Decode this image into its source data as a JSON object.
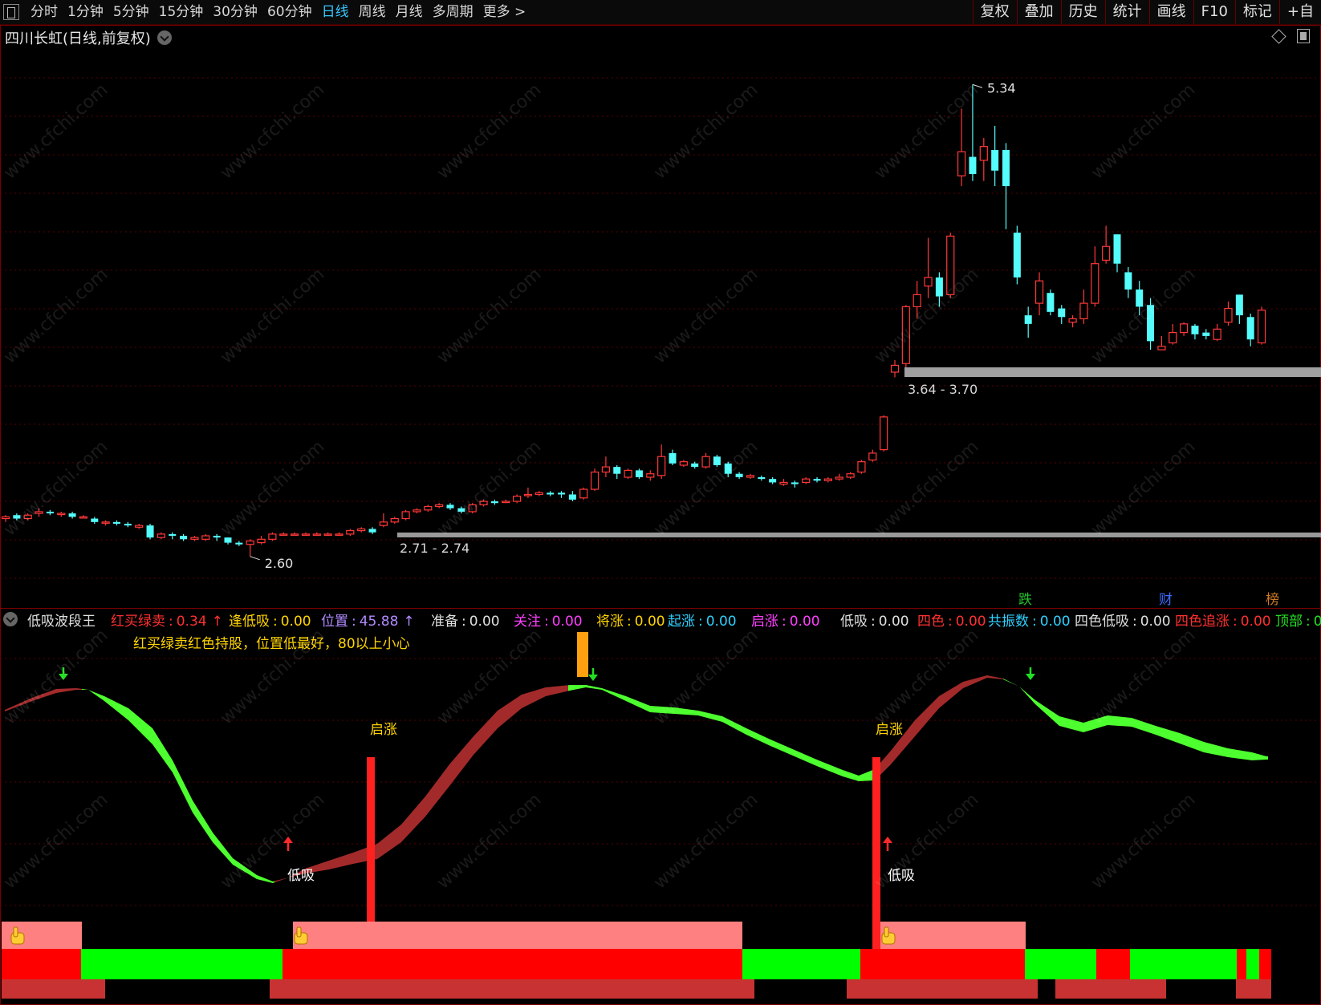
{
  "toolbar": {
    "periods": [
      "分时",
      "1分钟",
      "5分钟",
      "15分钟",
      "30分钟",
      "60分钟",
      "日线",
      "周线",
      "月线",
      "多周期",
      "更多 >"
    ],
    "active_period": "日线",
    "right_buttons": [
      "复权",
      "叠加",
      "历史",
      "统计",
      "画线",
      "F10",
      "标记",
      "+自"
    ]
  },
  "stock": {
    "title": "四川长虹(日线,前复权)"
  },
  "price_chart": {
    "high_label": "5.34",
    "low_label": "2.60",
    "band_low_label": "2.71 - 2.74",
    "band_high_label": "3.64 - 3.70",
    "markers": [
      {
        "text": "跌",
        "color": "#22c02a"
      },
      {
        "text": "财",
        "color": "#3b6cff"
      },
      {
        "text": "榜",
        "color": "#d07a20"
      }
    ],
    "price_range": [
      2.45,
      5.5
    ],
    "candles": [
      [
        2.82,
        2.83,
        2.8,
        2.84
      ],
      [
        2.84,
        2.82,
        2.81,
        2.85
      ],
      [
        2.82,
        2.84,
        2.81,
        2.85
      ],
      [
        2.85,
        2.86,
        2.83,
        2.88
      ],
      [
        2.86,
        2.85,
        2.84,
        2.87
      ],
      [
        2.85,
        2.85,
        2.83,
        2.86
      ],
      [
        2.85,
        2.83,
        2.82,
        2.86
      ],
      [
        2.83,
        2.83,
        2.82,
        2.84
      ],
      [
        2.82,
        2.8,
        2.79,
        2.83
      ],
      [
        2.8,
        2.8,
        2.78,
        2.81
      ],
      [
        2.8,
        2.79,
        2.78,
        2.81
      ],
      [
        2.79,
        2.78,
        2.77,
        2.8
      ],
      [
        2.77,
        2.78,
        2.76,
        2.79
      ],
      [
        2.78,
        2.71,
        2.7,
        2.79
      ],
      [
        2.71,
        2.73,
        2.7,
        2.74
      ],
      [
        2.73,
        2.72,
        2.7,
        2.74
      ],
      [
        2.72,
        2.7,
        2.69,
        2.73
      ],
      [
        2.7,
        2.71,
        2.69,
        2.72
      ],
      [
        2.7,
        2.72,
        2.69,
        2.73
      ],
      [
        2.72,
        2.71,
        2.69,
        2.73
      ],
      [
        2.71,
        2.68,
        2.67,
        2.71
      ],
      [
        2.68,
        2.67,
        2.66,
        2.69
      ],
      [
        2.67,
        2.69,
        2.6,
        2.7
      ],
      [
        2.68,
        2.7,
        2.67,
        2.72
      ],
      [
        2.7,
        2.73,
        2.69,
        2.74
      ],
      [
        2.73,
        2.73,
        2.72,
        2.74
      ],
      [
        2.73,
        2.73,
        2.72,
        2.74
      ],
      [
        2.73,
        2.73,
        2.72,
        2.74
      ],
      [
        2.73,
        2.73,
        2.72,
        2.74
      ],
      [
        2.73,
        2.73,
        2.72,
        2.74
      ],
      [
        2.73,
        2.73,
        2.72,
        2.74
      ],
      [
        2.73,
        2.75,
        2.72,
        2.76
      ],
      [
        2.75,
        2.76,
        2.74,
        2.77
      ],
      [
        2.76,
        2.74,
        2.73,
        2.77
      ],
      [
        2.78,
        2.8,
        2.77,
        2.85
      ],
      [
        2.8,
        2.82,
        2.79,
        2.83
      ],
      [
        2.82,
        2.86,
        2.81,
        2.87
      ],
      [
        2.86,
        2.87,
        2.85,
        2.88
      ],
      [
        2.87,
        2.89,
        2.86,
        2.9
      ],
      [
        2.89,
        2.9,
        2.88,
        2.91
      ],
      [
        2.9,
        2.88,
        2.87,
        2.91
      ],
      [
        2.88,
        2.86,
        2.85,
        2.89
      ],
      [
        2.86,
        2.9,
        2.85,
        2.91
      ],
      [
        2.9,
        2.92,
        2.89,
        2.93
      ],
      [
        2.92,
        2.91,
        2.9,
        2.93
      ],
      [
        2.92,
        2.92,
        2.91,
        2.93
      ],
      [
        2.92,
        2.95,
        2.91,
        2.96
      ],
      [
        2.96,
        2.96,
        2.94,
        3.0
      ],
      [
        2.96,
        2.97,
        2.95,
        2.98
      ],
      [
        2.97,
        2.96,
        2.95,
        2.98
      ],
      [
        2.97,
        2.96,
        2.94,
        2.98
      ],
      [
        2.96,
        2.93,
        2.92,
        2.98
      ],
      [
        2.94,
        2.99,
        2.93,
        3.0
      ],
      [
        2.99,
        3.09,
        2.98,
        3.11
      ],
      [
        3.09,
        3.12,
        3.06,
        3.18
      ],
      [
        3.12,
        3.08,
        3.05,
        3.13
      ],
      [
        3.06,
        3.1,
        3.05,
        3.11
      ],
      [
        3.1,
        3.06,
        3.05,
        3.11
      ],
      [
        3.06,
        3.08,
        3.04,
        3.1
      ],
      [
        3.07,
        3.18,
        3.05,
        3.25
      ],
      [
        3.2,
        3.14,
        3.13,
        3.22
      ],
      [
        3.13,
        3.15,
        3.12,
        3.16
      ],
      [
        3.14,
        3.12,
        3.11,
        3.15
      ],
      [
        3.12,
        3.18,
        3.11,
        3.2
      ],
      [
        3.18,
        3.13,
        3.12,
        3.19
      ],
      [
        3.14,
        3.08,
        3.06,
        3.15
      ],
      [
        3.08,
        3.06,
        3.05,
        3.09
      ],
      [
        3.06,
        3.07,
        3.05,
        3.08
      ],
      [
        3.06,
        3.05,
        3.04,
        3.07
      ],
      [
        3.05,
        3.03,
        3.02,
        3.06
      ],
      [
        3.02,
        3.03,
        3.01,
        3.05
      ],
      [
        3.03,
        3.02,
        3.0,
        3.04
      ],
      [
        3.03,
        3.05,
        3.02,
        3.06
      ],
      [
        3.05,
        3.04,
        3.03,
        3.06
      ],
      [
        3.04,
        3.05,
        3.03,
        3.06
      ],
      [
        3.05,
        3.06,
        3.04,
        3.08
      ],
      [
        3.06,
        3.08,
        3.05,
        3.09
      ],
      [
        3.09,
        3.15,
        3.08,
        3.16
      ],
      [
        3.16,
        3.2,
        3.15,
        3.22
      ],
      [
        3.22,
        3.41,
        3.21,
        3.42
      ],
      [
        3.67,
        3.71,
        3.64,
        3.74
      ],
      [
        3.72,
        4.05,
        3.66,
        4.06
      ],
      [
        4.05,
        4.12,
        3.98,
        4.2
      ],
      [
        4.17,
        4.22,
        4.1,
        4.45
      ],
      [
        4.22,
        4.11,
        4.05,
        4.25
      ],
      [
        4.12,
        4.46,
        4.1,
        4.48
      ],
      [
        4.81,
        4.95,
        4.75,
        5.2
      ],
      [
        4.92,
        4.82,
        4.78,
        5.34
      ],
      [
        4.9,
        4.98,
        4.78,
        5.03
      ],
      [
        4.96,
        4.84,
        4.75,
        5.1
      ],
      [
        4.96,
        4.75,
        4.5,
        5.0
      ],
      [
        4.48,
        4.22,
        4.18,
        4.52
      ],
      [
        4.0,
        3.95,
        3.87,
        4.05
      ],
      [
        4.07,
        4.2,
        4.0,
        4.25
      ],
      [
        4.13,
        4.02,
        4.0,
        4.15
      ],
      [
        4.04,
        3.99,
        3.95,
        4.06
      ],
      [
        3.96,
        3.98,
        3.93,
        4.0
      ],
      [
        3.98,
        4.07,
        3.95,
        4.15
      ],
      [
        4.07,
        4.3,
        4.05,
        4.4
      ],
      [
        4.32,
        4.4,
        4.3,
        4.52
      ],
      [
        4.47,
        4.3,
        4.25,
        4.47
      ],
      [
        4.25,
        4.15,
        4.1,
        4.28
      ],
      [
        4.15,
        4.05,
        4.0,
        4.2
      ],
      [
        4.06,
        3.85,
        3.8,
        4.1
      ],
      [
        3.8,
        3.82,
        3.8,
        3.88
      ],
      [
        3.84,
        3.9,
        3.83,
        3.95
      ],
      [
        3.9,
        3.95,
        3.88,
        3.96
      ],
      [
        3.94,
        3.89,
        3.86,
        3.95
      ],
      [
        3.9,
        3.88,
        3.86,
        3.92
      ],
      [
        3.86,
        3.92,
        3.85,
        3.95
      ],
      [
        3.96,
        4.04,
        3.94,
        4.08
      ],
      [
        4.12,
        4.0,
        3.95,
        4.12
      ],
      [
        3.99,
        3.86,
        3.82,
        4.01
      ],
      [
        3.84,
        4.03,
        3.83,
        4.05
      ]
    ]
  },
  "indicator": {
    "name": "低吸波段王",
    "items": [
      {
        "label": "红买绿卖",
        "value": "0.34",
        "arrow": "↑",
        "color": "#ff3030"
      },
      {
        "label": "逢低吸",
        "value": "0.00",
        "arrow": "",
        "color": "#ffd400"
      },
      {
        "label": "位置",
        "value": "45.88",
        "arrow": "↑",
        "color": "#b08aff"
      },
      {
        "label": "准备",
        "value": "0.00",
        "arrow": "",
        "color": "#e0e0e0"
      },
      {
        "label": "关注",
        "value": "0.00",
        "arrow": "",
        "color": "#ff40ff"
      },
      {
        "label": "将涨",
        "value": "0.00",
        "arrow": "",
        "color": "#ffd400"
      },
      {
        "label": "起涨",
        "value": "0.00",
        "arrow": "",
        "color": "#30d0ff"
      },
      {
        "label": "启涨",
        "value": "0.00",
        "arrow": "",
        "color": "#ff40ff"
      },
      {
        "label": "低吸",
        "value": "0.00",
        "arrow": "",
        "color": "#e0e0e0"
      },
      {
        "label": "四色",
        "value": "0.00",
        "arrow": "",
        "color": "#ff3030"
      },
      {
        "label": "共振数",
        "value": "0.00",
        "arrow": "",
        "color": "#30d0ff"
      },
      {
        "label": "四色低吸",
        "value": "0.00",
        "arrow": "",
        "color": "#e0e0e0"
      },
      {
        "label": "四色追涨",
        "value": "0.00",
        "arrow": "",
        "color": "#ff3030"
      },
      {
        "label": "顶部",
        "value": "0",
        "arrow": "",
        "color": "#22e022"
      }
    ],
    "description": "红买绿卖红色持股，位置低最好，80以上小心",
    "annotations": {
      "start_rise": "启涨",
      "low_buy": "低吸"
    }
  },
  "watermark": "www.cfchi.com",
  "colors": {
    "up": "#ff3838",
    "down": "#54fcfc",
    "wave_up": "#a32a2a",
    "wave_down": "#4dff2e"
  }
}
